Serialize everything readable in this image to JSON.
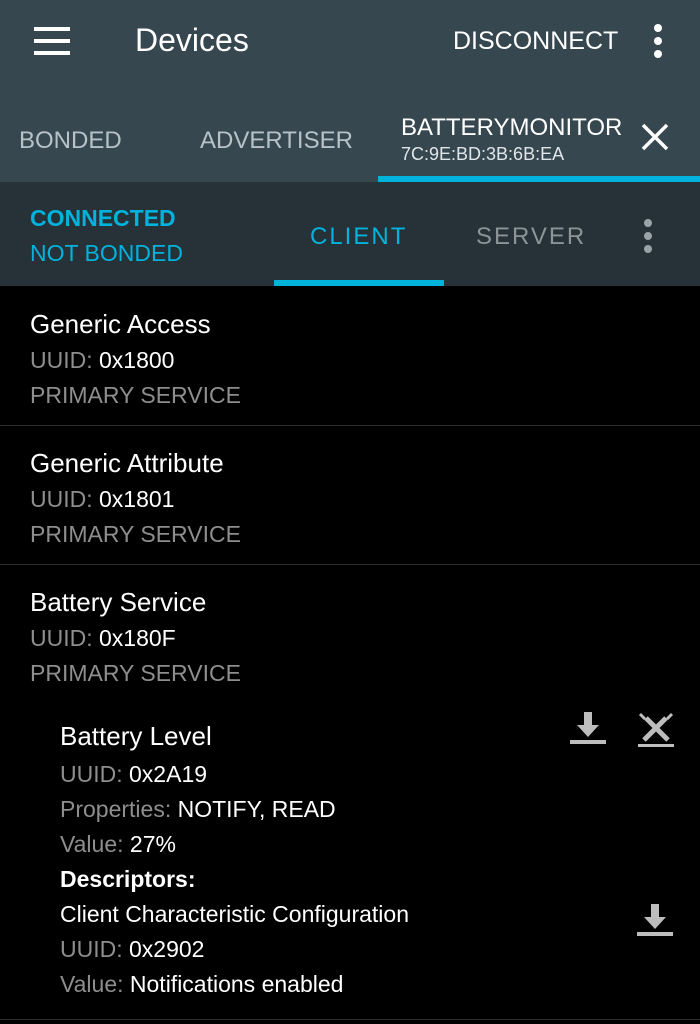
{
  "appbar": {
    "title": "Devices",
    "disconnect_label": "DISCONNECT",
    "menu_icon": "hamburger-menu-icon",
    "overflow_icon": "more-vert-icon"
  },
  "tabs": {
    "bonded": "BONDED",
    "advertiser": "ADVERTISER",
    "active_name": "BATTERYMONITOR",
    "active_address": "7C:9E:BD:3B:6B:EA",
    "close_icon": "close-icon"
  },
  "connection": {
    "state": "CONNECTED",
    "bond_state": "NOT BONDED",
    "client_tab": "CLIENT",
    "server_tab": "SERVER"
  },
  "labels": {
    "uuid": "UUID:",
    "properties": "Properties:",
    "value": "Value:",
    "descriptors": "Descriptors:"
  },
  "services": [
    {
      "name": "Generic Access",
      "uuid": "0x1800",
      "type": "PRIMARY SERVICE"
    },
    {
      "name": "Generic Attribute",
      "uuid": "0x1801",
      "type": "PRIMARY SERVICE"
    },
    {
      "name": "Battery Service",
      "uuid": "0x180F",
      "type": "PRIMARY SERVICE"
    }
  ],
  "characteristic": {
    "name": "Battery Level",
    "uuid": "0x2A19",
    "properties": "NOTIFY, READ",
    "value": "27%",
    "icons": [
      "read-download-icon",
      "notifications-toggle-icon"
    ]
  },
  "descriptor": {
    "name": "Client Characteristic Configuration",
    "uuid": "0x2902",
    "value": "Notifications enabled",
    "icon": "read-download-icon"
  },
  "colors": {
    "appbar": "#37474f",
    "subbar": "#263238",
    "accent": "#00b3dc",
    "background": "#000000",
    "secondary_text": "#8e8e8e"
  }
}
